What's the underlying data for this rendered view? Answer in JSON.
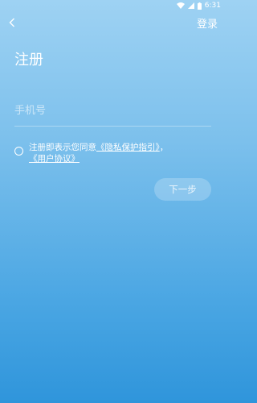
{
  "status_bar": {
    "time": "6:31",
    "icons": [
      "wifi-icon",
      "signal-icon",
      "battery-icon"
    ]
  },
  "header": {
    "back_icon": "chevron-left-icon",
    "login_label": "登录"
  },
  "page": {
    "title": "注册"
  },
  "phone_input": {
    "value": "",
    "placeholder": "手机号"
  },
  "agreement": {
    "checked": false,
    "prefix": "注册即表示您同意",
    "privacy_link": "《隐私保护指引》",
    "separator": "，",
    "user_link": "《用户协议》"
  },
  "next_button": {
    "label": "下一步",
    "enabled": false
  },
  "colors": {
    "gradient_top": "#9ed2f3",
    "gradient_bottom": "#2f95db",
    "text": "#ffffff"
  }
}
